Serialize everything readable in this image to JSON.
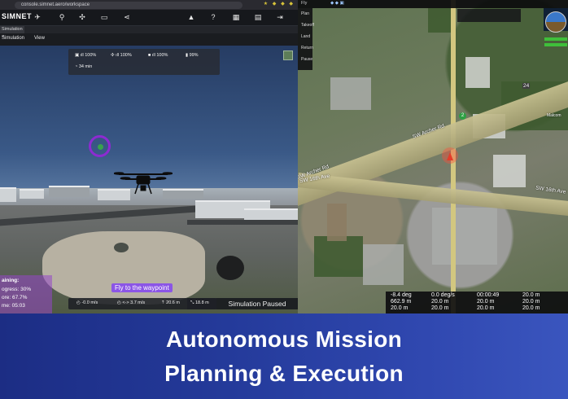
{
  "browser": {
    "url": "console.simnet.aero/workspace"
  },
  "app": {
    "logo": "SIMNET",
    "tab": "Simulation",
    "menu": [
      "Simulation",
      "View"
    ]
  },
  "toolbar_icons": [
    "plane-icon",
    "map-pin-icon",
    "drone-icon",
    "square-icon",
    "share-icon",
    "alert-icon",
    "help-icon",
    "grid-icon",
    "book-icon",
    "exit-icon"
  ],
  "stats": {
    "signal_1": "100%",
    "signal_2": "100%",
    "video": "100%",
    "battery": "99%",
    "flight_time": "34 min"
  },
  "training": {
    "heading": "aining:",
    "progress": "ogress: 30%",
    "score": "ore: 67.7%",
    "time": "me: 05:03"
  },
  "instruction": "Fly to the waypoint",
  "hud": {
    "vertical_speed": "-0.0 m/s",
    "horizontal_speed": "<-> 3.7 m/s",
    "altitude": "20.6 m",
    "distance": "18.8 m"
  },
  "sim_status": "Simulation Paused",
  "map": {
    "mode": "Fly",
    "tools": [
      "Plan",
      "Takeoff",
      "Land",
      "Return",
      "Pause"
    ],
    "waypoint_number": "2",
    "roads": [
      "SW Archer Rd",
      "SW Archer Rd",
      "SW 16th Ave",
      "SW 16th Ave",
      "24"
    ],
    "place_label": "Malcom",
    "telemetry": {
      "row1": [
        "-8.4 deg",
        "0.0 deg/s",
        "00:00:49",
        "20.0 m"
      ],
      "row2": [
        "662.9 m",
        "20.0 m",
        "20.0 m",
        "20.0 m"
      ],
      "row3": [
        "20.0 m",
        "20.0 m",
        "20.0 m",
        "20.0 m"
      ]
    }
  },
  "banner": {
    "line1": "Autonomous Mission",
    "line2": "Planning & Execution"
  }
}
